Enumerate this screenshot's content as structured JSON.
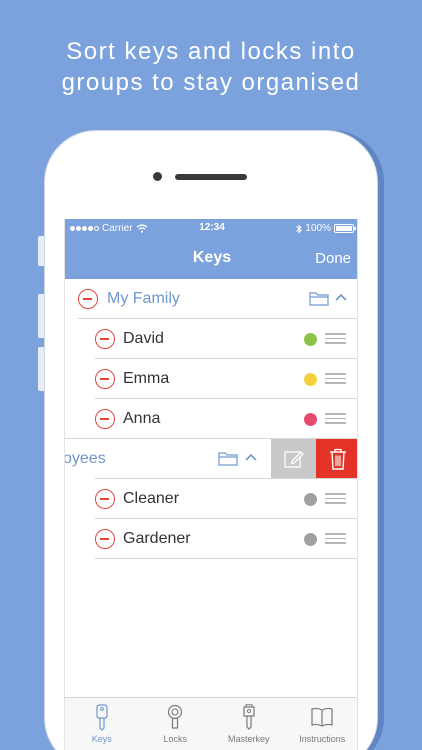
{
  "headline": [
    "Sort keys and locks into",
    "groups to stay organised"
  ],
  "colors": {
    "accent": "#7ba2dc",
    "delete": "#e4342a",
    "remove": "#e1463d"
  },
  "status_bar": {
    "carrier": "Carrier",
    "time": "12:34",
    "battery": "100%"
  },
  "nav": {
    "title": "Keys",
    "done_label": "Done"
  },
  "list": [
    {
      "type": "group",
      "label": "My Family",
      "icons": [
        "folder-icon",
        "chevron-up-icon"
      ]
    },
    {
      "type": "key",
      "label": "David",
      "color": "#8bc34a"
    },
    {
      "type": "key",
      "label": "Emma",
      "color": "#f4d03f"
    },
    {
      "type": "key",
      "label": "Anna",
      "color": "#e84a6f"
    },
    {
      "type": "group",
      "label": "oyees",
      "swiped": true,
      "actions": [
        "edit-icon",
        "trash-icon"
      ]
    },
    {
      "type": "key",
      "label": "Cleaner",
      "color": "#a0a0a0"
    },
    {
      "type": "key",
      "label": "Gardener",
      "color": "#a0a0a0"
    }
  ],
  "tabs": [
    {
      "label": "Keys",
      "icon": "key-icon",
      "active": true
    },
    {
      "label": "Locks",
      "icon": "lock-icon",
      "active": false
    },
    {
      "label": "Masterkey",
      "icon": "masterkey-icon",
      "active": false
    },
    {
      "label": "Instructions",
      "icon": "book-icon",
      "active": false
    }
  ]
}
